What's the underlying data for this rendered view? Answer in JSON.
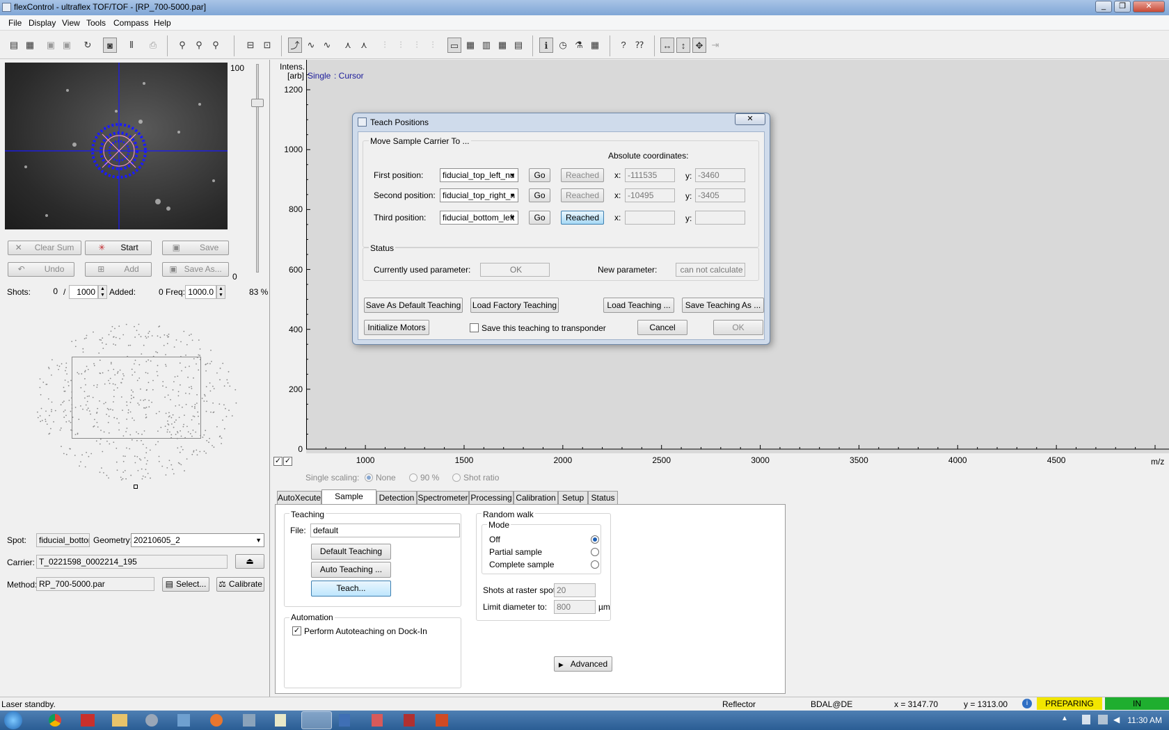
{
  "window": {
    "title": "flexControl - ultraflex TOF/TOF - [RP_700-5000.par]"
  },
  "menu": [
    "File",
    "Display",
    "View",
    "Tools",
    "Compass",
    "Help"
  ],
  "camera": {
    "slider_max": "100",
    "slider_min": "0",
    "zoom": "83 %"
  },
  "acq_buttons": {
    "clear_sum": "Clear Sum",
    "start": "Start",
    "save": "Save",
    "undo": "Undo",
    "add": "Add",
    "save_as": "Save As..."
  },
  "shots": {
    "label": "Shots:",
    "value": "0",
    "sep": "/",
    "total": "1000",
    "added_label": "Added:",
    "added": "0",
    "freq_label": "Freq:",
    "freq": "1000.0"
  },
  "spot": {
    "label": "Spot:",
    "value": "fiducial_bottom",
    "geometry_label": "Geometry:",
    "geometry": "20210605_2"
  },
  "carrier": {
    "label": "Carrier:",
    "value": "T_0221598_0002214_195"
  },
  "method": {
    "label": "Method:",
    "value": "RP_700-5000.par",
    "select": "Select...",
    "calibrate": "Calibrate"
  },
  "plot": {
    "ylabel_top": "Intens.",
    "ylabel_unit": "[arb]",
    "mode": "Single",
    "cursor": ": Cursor",
    "xlabel": "m/z",
    "single_scaling": "Single scaling:",
    "scaling_options": [
      "None",
      "90 %",
      "Shot ratio"
    ]
  },
  "chart_data": {
    "type": "line",
    "title": "",
    "xlabel": "m/z",
    "ylabel": "Intens. [arb]",
    "xlim": [
      700,
      5000
    ],
    "ylim": [
      0,
      1300
    ],
    "xticks": [
      1000,
      1500,
      2000,
      2500,
      3000,
      3500,
      4000,
      4500
    ],
    "yticks": [
      0,
      200,
      400,
      600,
      800,
      1000,
      1200
    ],
    "series": []
  },
  "tabs": [
    "AutoXecute",
    "Sample Carrier",
    "Detection",
    "Spectrometer",
    "Processing",
    "Calibration",
    "Setup",
    "Status"
  ],
  "teaching": {
    "title": "Teaching",
    "file_label": "File:",
    "file_value": "default",
    "default_btn": "Default Teaching",
    "auto_btn": "Auto Teaching ...",
    "teach_btn": "Teach..."
  },
  "automation": {
    "title": "Automation",
    "autoteach": "Perform Autoteaching on Dock-In"
  },
  "random_walk": {
    "title": "Random walk",
    "mode_title": "Mode",
    "modes": [
      "Off",
      "Partial sample",
      "Complete sample"
    ],
    "shots_label": "Shots at raster spot:",
    "shots_value": "20",
    "limit_label": "Limit diameter to:",
    "limit_value": "800",
    "limit_unit": "µm",
    "advanced": "Advanced"
  },
  "dialog": {
    "title": "Teach Positions",
    "move_title": "Move Sample Carrier To ...",
    "abs_coords": "Absolute coordinates:",
    "rows": [
      {
        "label": "First position:",
        "combo": "fiducial_top_left_nu",
        "go": "Go",
        "reached": "Reached",
        "x": "-111535",
        "y": "-3460"
      },
      {
        "label": "Second position:",
        "combo": "fiducial_top_right_n",
        "go": "Go",
        "reached": "Reached",
        "x": "-10495",
        "y": "-3405"
      },
      {
        "label": "Third position:",
        "combo": "fiducial_bottom_left",
        "go": "Go",
        "reached": "Reached",
        "x": "",
        "y": ""
      }
    ],
    "x_label": "x:",
    "y_label": "y:",
    "status_title": "Status",
    "current_label": "Currently used parameter:",
    "current_value": "OK",
    "new_label": "New parameter:",
    "new_value": "can not calculate",
    "save_default": "Save As Default Teaching",
    "load_factory": "Load Factory Teaching",
    "load_teaching": "Load Teaching ...",
    "save_teaching": "Save Teaching As ...",
    "init_motors": "Initialize Motors",
    "save_transponder": "Save this teaching to transponder",
    "cancel": "Cancel",
    "ok": "OK"
  },
  "statusbar": {
    "message": "Laser standby.",
    "mode": "Reflector",
    "user": "BDAL@DE",
    "x": "x = 3147.70",
    "y": "y = 1313.00",
    "state": "PREPARING",
    "inout": "IN"
  },
  "taskbar": {
    "time": "11:30 AM"
  },
  "colors": {
    "preparing": "#f2e600",
    "in": "#1fae2f",
    "accent": "#1e5fb4",
    "crosshair": "#1a1aff"
  }
}
